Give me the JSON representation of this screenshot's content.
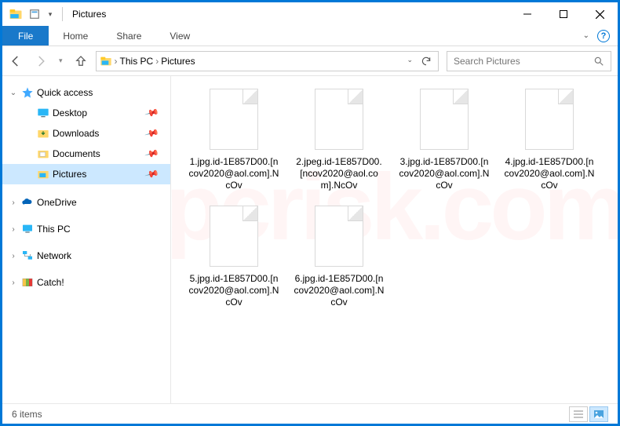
{
  "title": "Pictures",
  "ribbon": {
    "file": "File",
    "tabs": [
      "Home",
      "Share",
      "View"
    ]
  },
  "breadcrumbs": [
    "This PC",
    "Pictures"
  ],
  "search_placeholder": "Search Pictures",
  "sidebar": {
    "quick_access": "Quick access",
    "items": [
      "Desktop",
      "Downloads",
      "Documents",
      "Pictures"
    ],
    "roots": [
      "OneDrive",
      "This PC",
      "Network",
      "Catch!"
    ]
  },
  "files": [
    "1.jpg.id-1E857D00.[ncov2020@aol.com].NcOv",
    "2.jpeg.id-1E857D00.[ncov2020@aol.com].NcOv",
    "3.jpg.id-1E857D00.[ncov2020@aol.com].NcOv",
    "4.jpg.id-1E857D00.[ncov2020@aol.com].NcOv",
    "5.jpg.id-1E857D00.[ncov2020@aol.com].NcOv",
    "6.jpg.id-1E857D00.[ncov2020@aol.com].NcOv"
  ],
  "status": "6 items",
  "watermark": "pcrisk.com"
}
